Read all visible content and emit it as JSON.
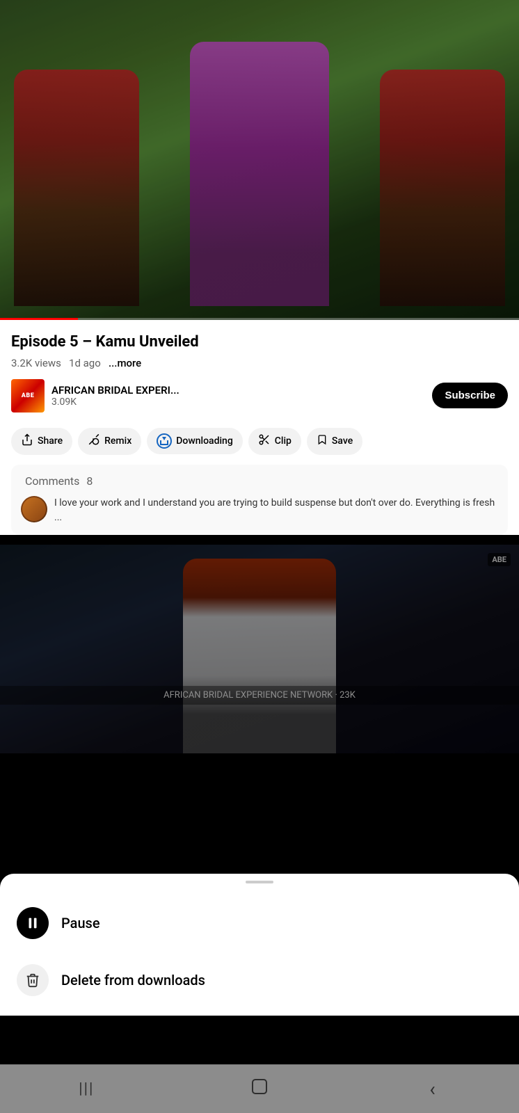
{
  "video_top": {
    "alt": "African bridal scene with traditional costumes"
  },
  "info": {
    "title": "Episode 5 – Kamu Unveiled",
    "views": "3.2K views",
    "age": "1d ago",
    "more_label": "...more"
  },
  "channel": {
    "logo_text": "ABE",
    "name": "AFRICAN BRIDAL EXPERI...",
    "subscribers": "3.09K",
    "subscribe_label": "Subscribe"
  },
  "actions": [
    {
      "id": "share",
      "icon": "↗",
      "label": "Share"
    },
    {
      "id": "remix",
      "icon": "⟳",
      "label": "Remix"
    },
    {
      "id": "downloading",
      "icon": "download",
      "label": "Downloading"
    },
    {
      "id": "clip",
      "icon": "✂",
      "label": "Clip"
    },
    {
      "id": "save",
      "icon": "🔖",
      "label": "Save"
    }
  ],
  "comments": {
    "header": "Comments",
    "count": "8",
    "preview_text": "I love your work and I understand you are trying to build suspense but don't over do. Everything is fresh ..."
  },
  "video_bottom": {
    "watermark": "ABE",
    "caption": "AFRICAN BRIDAL EXPERIENCE NETWORK · 23K"
  },
  "bottom_sheet": {
    "handle": "",
    "items": [
      {
        "id": "pause",
        "icon_type": "pause",
        "label": "Pause"
      },
      {
        "id": "delete",
        "icon_type": "delete",
        "label": "Delete from downloads"
      }
    ]
  },
  "nav_bar": {
    "buttons": [
      {
        "id": "back",
        "icon": "|||"
      },
      {
        "id": "home",
        "icon": "○"
      },
      {
        "id": "recent",
        "icon": "‹"
      }
    ]
  }
}
